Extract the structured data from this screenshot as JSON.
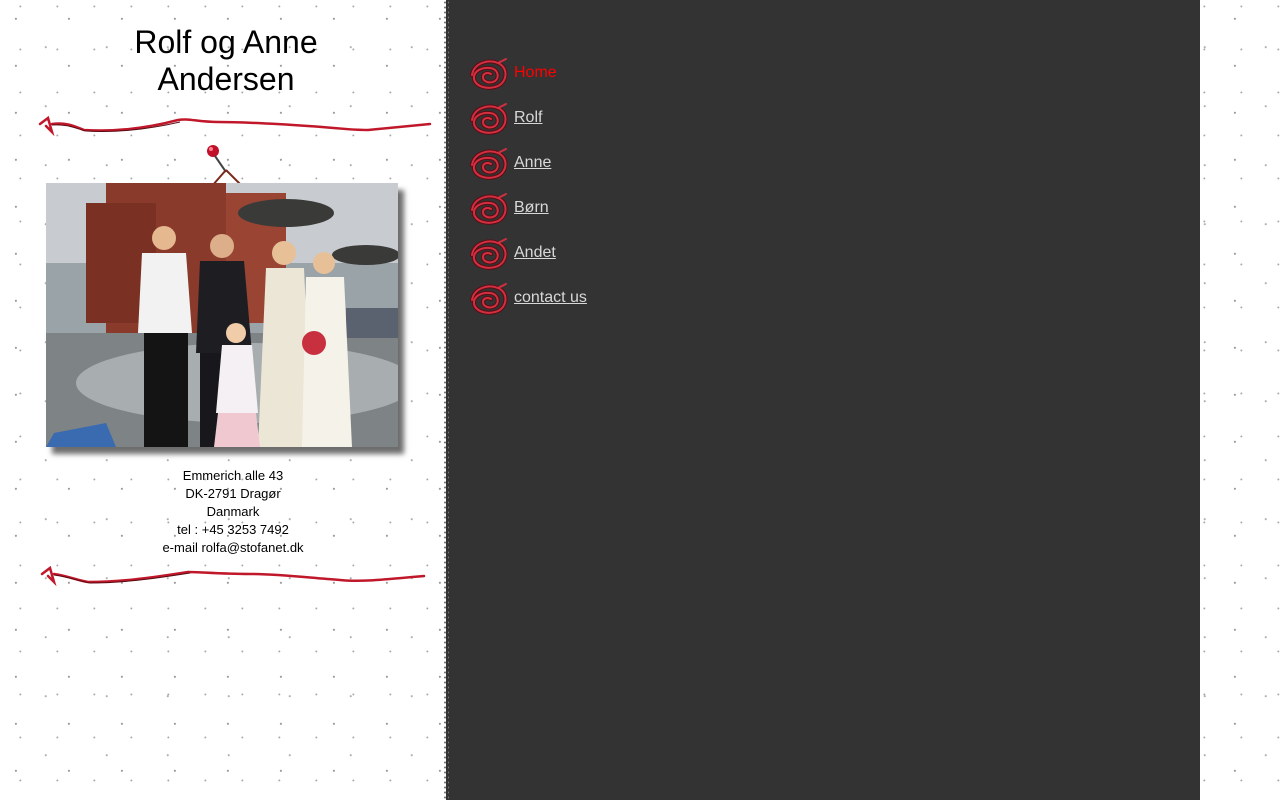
{
  "header": {
    "title": "Rolf og Anne Andersen"
  },
  "photo": {
    "alt": "Family photo"
  },
  "address": {
    "street": "Emmerich alle 43",
    "city": "DK-2791 Dragør",
    "country": "Danmark",
    "phone": "tel : +45 3253 7492",
    "email": "e-mail rolfa@stofanet.dk"
  },
  "nav": {
    "icon": "spiral-icon",
    "items": [
      {
        "label": "Home",
        "active": true
      },
      {
        "label": "Rolf",
        "active": false
      },
      {
        "label": "Anne",
        "active": false
      },
      {
        "label": "Børn",
        "active": false
      },
      {
        "label": "Andet",
        "active": false
      },
      {
        "label": "contact us",
        "active": false
      }
    ]
  },
  "colors": {
    "accent": "#ff0000",
    "sidebar_bg": "#333333",
    "link": "#d8d8d8",
    "divider": "#c0182a"
  }
}
